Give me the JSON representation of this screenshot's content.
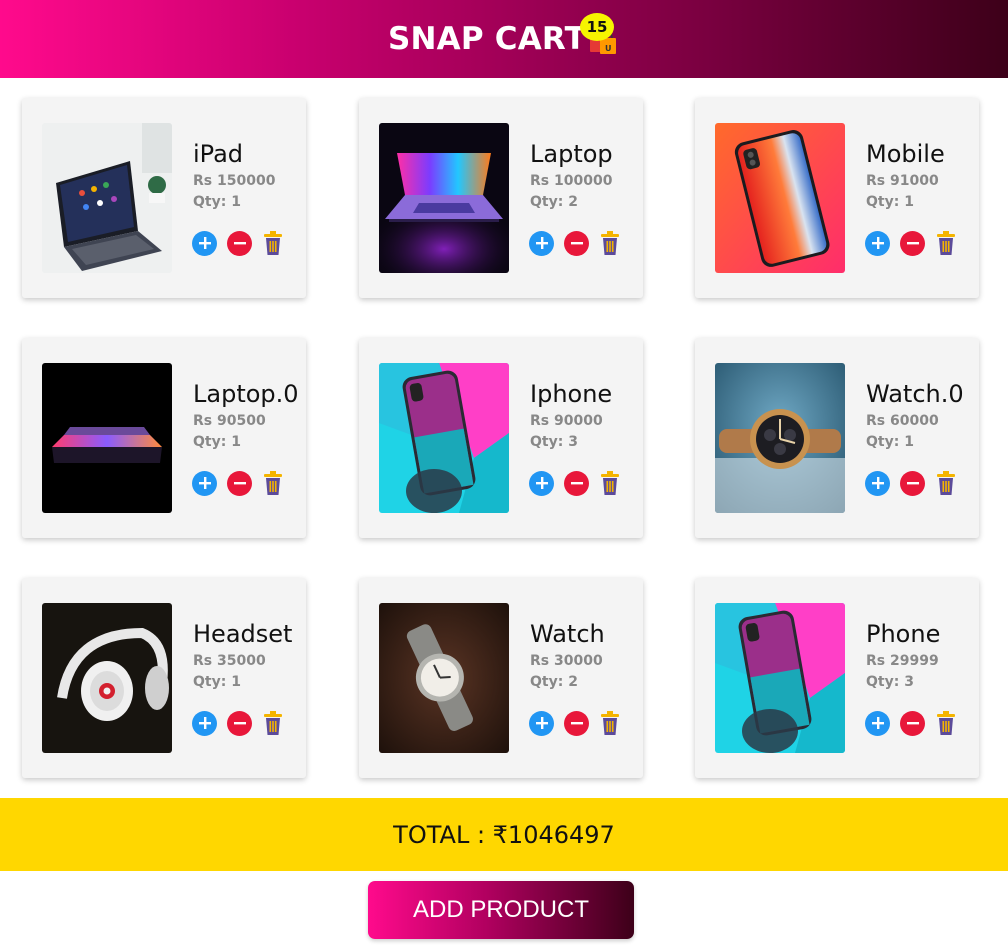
{
  "header": {
    "title": "SNAP CART",
    "cart_count": "15",
    "cart_icon": "shopping-bags-icon"
  },
  "products": [
    {
      "name": "iPad",
      "price": "Rs 150000",
      "qty": "Qty: 1",
      "image": "ipad-with-keyboard-photo"
    },
    {
      "name": "Laptop",
      "price": "Rs 100000",
      "qty": "Qty: 2",
      "image": "laptop-glowing-screen-photo"
    },
    {
      "name": "Mobile",
      "price": "Rs 91000",
      "qty": "Qty: 1",
      "image": "red-phone-back-photo"
    },
    {
      "name": "Laptop.0",
      "price": "Rs 90500",
      "qty": "Qty: 1",
      "image": "laptop-dark-photo"
    },
    {
      "name": "Iphone",
      "price": "Rs 90000",
      "qty": "Qty: 3",
      "image": "iphone-in-hand-photo"
    },
    {
      "name": "Watch.0",
      "price": "Rs 60000",
      "qty": "Qty: 1",
      "image": "chronograph-watch-photo"
    },
    {
      "name": "Headset",
      "price": "Rs 35000",
      "qty": "Qty: 1",
      "image": "beats-headphones-photo"
    },
    {
      "name": "Watch",
      "price": "Rs 30000",
      "qty": "Qty: 2",
      "image": "wrist-watch-photo"
    },
    {
      "name": "Phone",
      "price": "Rs 29999",
      "qty": "Qty: 3",
      "image": "iphone-in-hand-photo"
    }
  ],
  "actions": {
    "increase_icon": "plus-circle-icon",
    "decrease_icon": "minus-circle-icon",
    "delete_icon": "trash-icon"
  },
  "total": {
    "label": "TOTAL : ₹1046497"
  },
  "add_product": {
    "label": "ADD PRODUCT"
  },
  "colors": {
    "header_start": "#ff0a8c",
    "header_end": "#3d0019",
    "badge": "#f6f400",
    "plus": "#2196f3",
    "minus": "#e8173a",
    "total_bar": "#ffd700"
  }
}
